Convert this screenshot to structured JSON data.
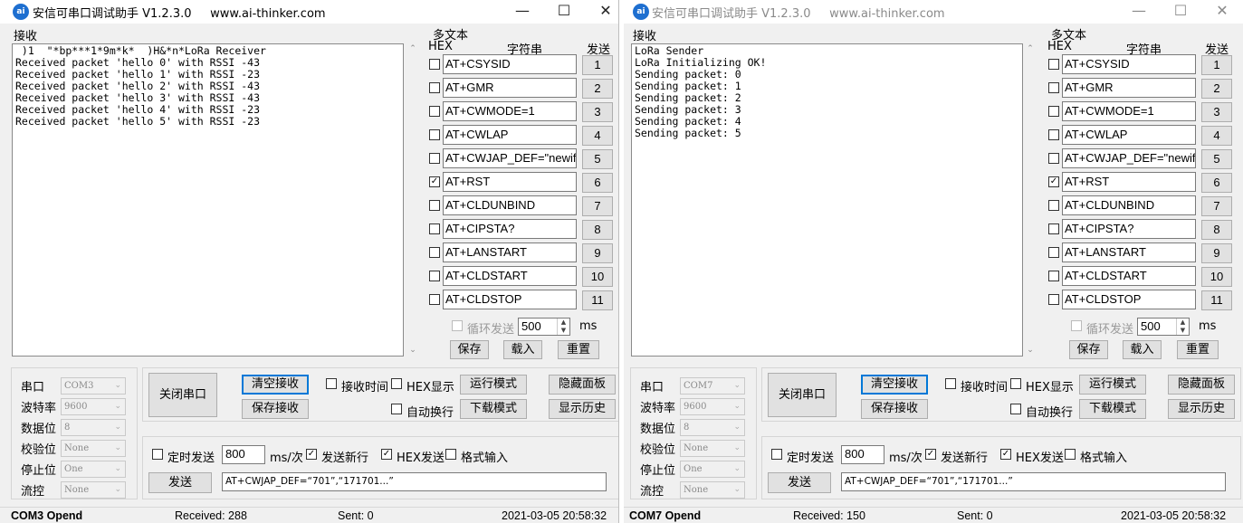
{
  "left": {
    "title": "安信可串口调试助手 V1.2.3.0     www.ai-thinker.com",
    "icon": "ai",
    "receive_label": "接收",
    "receive_text": " )1  \"*bp***1*9m*k*  )H&*n*LoRa Receiver\nReceived packet 'hello 0' with RSSI -43\nReceived packet 'hello 1' with RSSI -23\nReceived packet 'hello 2' with RSSI -43\nReceived packet 'hello 3' with RSSI -43\nReceived packet 'hello 4' with RSSI -23\nReceived packet 'hello 5' with RSSI -23",
    "port_value": "COM3",
    "recv_count": "Received: 288",
    "sent_count": "Sent: 0",
    "status_port": "COM3 Opend",
    "timestamp": "2021-03-05 20:58:32"
  },
  "right": {
    "title": "安信可串口调试助手 V1.2.3.0     www.ai-thinker.com",
    "icon": "ai",
    "receive_label": "接收",
    "receive_text": "LoRa Sender\nLoRa Initializing OK!\nSending packet: 0\nSending packet: 1\nSending packet: 2\nSending packet: 3\nSending packet: 4\nSending packet: 5",
    "port_value": "COM7",
    "recv_count": "Received: 150",
    "sent_count": "Sent: 0",
    "status_port": "COM7 Opend",
    "timestamp": "2021-03-05 20:58:32"
  },
  "common": {
    "multi_text_label": "多文本",
    "hex_header": "HEX",
    "string_header": "字符串",
    "send_header": "发送",
    "commands": [
      {
        "text": "AT+CSYSID",
        "num": "1",
        "checked": false
      },
      {
        "text": "AT+GMR",
        "num": "2",
        "checked": false
      },
      {
        "text": "AT+CWMODE=1",
        "num": "3",
        "checked": false
      },
      {
        "text": "AT+CWLAP",
        "num": "4",
        "checked": false
      },
      {
        "text": "AT+CWJAP_DEF=\"newifi_",
        "num": "5",
        "checked": false
      },
      {
        "text": "AT+RST",
        "num": "6",
        "checked": true
      },
      {
        "text": "AT+CLDUNBIND",
        "num": "7",
        "checked": false
      },
      {
        "text": "AT+CIPSTA?",
        "num": "8",
        "checked": false
      },
      {
        "text": "AT+LANSTART",
        "num": "9",
        "checked": false
      },
      {
        "text": "AT+CLDSTART",
        "num": "10",
        "checked": false
      },
      {
        "text": "AT+CLDSTOP",
        "num": "11",
        "checked": false
      }
    ],
    "loop_send_label": "循环发送",
    "loop_interval": "500",
    "ms_label": "ms",
    "save_label": "保存",
    "load_label": "载入",
    "reset_label": "重置",
    "port_label": "串口",
    "baud_label": "波特率",
    "baud_value": "9600",
    "databits_label": "数据位",
    "databits_value": "8",
    "parity_label": "校验位",
    "parity_value": "None",
    "stopbits_label": "停止位",
    "stopbits_value": "One",
    "flow_label": "流控",
    "flow_value": "None",
    "close_port_button": "关闭串口",
    "clear_recv_button": "清空接收",
    "save_recv_button": "保存接收",
    "recv_time_label": "接收时间",
    "hex_display_label": "HEX显示",
    "run_mode_button": "运行模式",
    "hide_panel_button": "隐藏面板",
    "auto_wrap_label": "自动换行",
    "download_mode_button": "下载模式",
    "show_history_button": "显示历史",
    "timed_send_label": "定时发送",
    "timed_interval": "800",
    "ms_per_label": "ms/次",
    "send_newline_label": "发送新行",
    "hex_send_label": "HEX发送",
    "format_input_label": "格式输入",
    "send_button": "发送",
    "send_text": "AT+CWJAP_DEF=“701”,“171701...”"
  },
  "icons": {
    "minimize": "minimize-icon",
    "maximize": "maximize-icon",
    "close": "close-icon"
  },
  "colors": {
    "focus_border": "#0078d7",
    "button_bg": "#e1e1e1",
    "window_bg": "#f0f0f0",
    "app_icon": "#1e6fd0"
  }
}
